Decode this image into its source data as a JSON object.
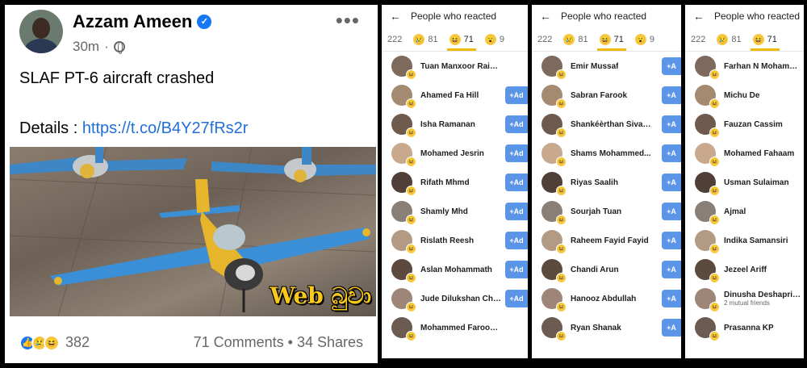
{
  "post": {
    "author": "Azzam Ameen",
    "time": "30m",
    "more_label": "•••",
    "text": "SLAF PT-6 aircraft crashed",
    "details_label": "Details : ",
    "details_link": "https://t.co/B4Y27fRs2r",
    "watermark": "Web බුවා",
    "reaction_count": "382",
    "comments_shares": "71 Comments • 34 Shares"
  },
  "panels": [
    {
      "title": "People who reacted",
      "tabs": [
        {
          "label": "222",
          "emoji": ""
        },
        {
          "label": "81",
          "emoji": "sad"
        },
        {
          "label": "71",
          "emoji": "haha",
          "active": true
        },
        {
          "label": "9",
          "emoji": "wow"
        }
      ],
      "people": [
        {
          "name": "Tuan Manxoor Rainudeen",
          "button": ""
        },
        {
          "name": "Ahamed Fa Hill",
          "button": "Ad"
        },
        {
          "name": "Isha Ramanan",
          "button": "Ad"
        },
        {
          "name": "Mohamed Jesrin",
          "button": "Ad"
        },
        {
          "name": "Rifath Mhmd",
          "button": "Ad"
        },
        {
          "name": "Shamly Mhd",
          "button": "Ad"
        },
        {
          "name": "Rislath Reesh",
          "button": "Ad"
        },
        {
          "name": "Aslan Mohammath",
          "button": "Ad"
        },
        {
          "name": "Jude Dilukshan Chri...",
          "button": "Ad"
        },
        {
          "name": "Mohammed Farooq Ahmed",
          "button": ""
        }
      ]
    },
    {
      "title": "People who reacted",
      "tabs": [
        {
          "label": "222",
          "emoji": ""
        },
        {
          "label": "81",
          "emoji": "sad"
        },
        {
          "label": "71",
          "emoji": "haha",
          "active": true
        },
        {
          "label": "9",
          "emoji": "wow"
        }
      ],
      "people": [
        {
          "name": "Emir Mussaf",
          "button": "A"
        },
        {
          "name": "Sabran Farook",
          "button": "A"
        },
        {
          "name": "Šhankéèrthan Šivap...",
          "button": "A"
        },
        {
          "name": "Shams Mohammed...",
          "button": "A"
        },
        {
          "name": "Riyas Saalih",
          "button": "A"
        },
        {
          "name": "Sourjah Tuan",
          "button": "A"
        },
        {
          "name": "Raheem Fayid Fayid",
          "button": "A"
        },
        {
          "name": "Chandi Arun",
          "button": "A"
        },
        {
          "name": "Hanooz Abdullah",
          "button": "A"
        },
        {
          "name": "Ryan Shanak",
          "button": "A"
        }
      ]
    },
    {
      "title": "People who reacted",
      "tabs": [
        {
          "label": "222",
          "emoji": ""
        },
        {
          "label": "81",
          "emoji": "sad"
        },
        {
          "label": "71",
          "emoji": "haha",
          "active": true
        }
      ],
      "people": [
        {
          "name": "Farhan N Mohammed",
          "button": ""
        },
        {
          "name": "Michu De",
          "button": ""
        },
        {
          "name": "Fauzan Cassim",
          "button": ""
        },
        {
          "name": "Mohamed Fahaam",
          "button": ""
        },
        {
          "name": "Usman Sulaiman",
          "button": ""
        },
        {
          "name": "Ajmal",
          "button": ""
        },
        {
          "name": "Indika Samansiri",
          "button": ""
        },
        {
          "name": "Jezeel Ariff",
          "button": ""
        },
        {
          "name": "Dinusha Deshapriya...",
          "sub": "2 mutual friends",
          "button": ""
        },
        {
          "name": "Prasanna KP",
          "button": ""
        }
      ]
    }
  ]
}
